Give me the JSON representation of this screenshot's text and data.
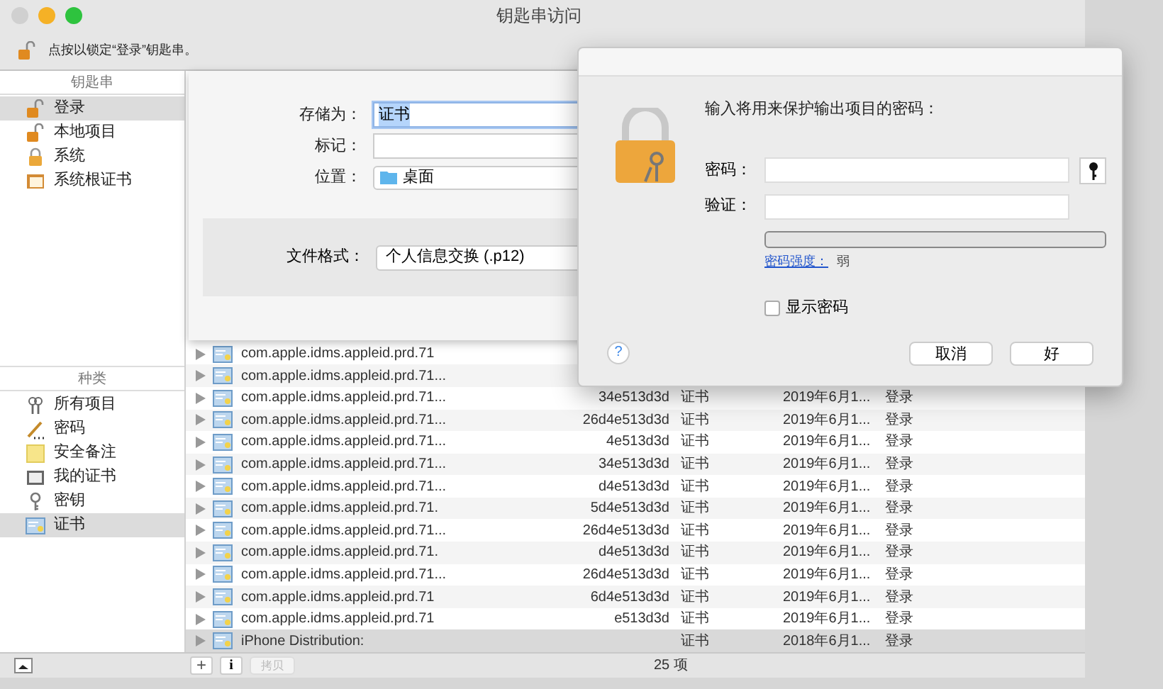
{
  "window": {
    "title": "钥匙串访问"
  },
  "toolbar": {
    "lock_message": "点按以锁定“登录”钥匙串。"
  },
  "sidebar": {
    "keychains": {
      "title": "钥匙串",
      "items": [
        {
          "label": "登录",
          "kind": "unlocked",
          "selected": true
        },
        {
          "label": "本地项目",
          "kind": "unlocked",
          "selected": false
        },
        {
          "label": "系统",
          "kind": "locked",
          "selected": false
        },
        {
          "label": "系统根证书",
          "kind": "cabinet",
          "selected": false
        }
      ]
    },
    "categories": {
      "title": "种类",
      "items": [
        {
          "label": "所有项目",
          "kind": "keys",
          "selected": false
        },
        {
          "label": "密码",
          "kind": "pencil",
          "selected": false
        },
        {
          "label": "安全备注",
          "kind": "note",
          "selected": false
        },
        {
          "label": "我的证书",
          "kind": "mycert",
          "selected": false
        },
        {
          "label": "密钥",
          "kind": "key",
          "selected": false
        },
        {
          "label": "证书",
          "kind": "cert",
          "selected": true
        }
      ]
    }
  },
  "items": [
    {
      "name": "com.apple.idms.appleid.prd.71",
      "selected": false
    },
    {
      "name": "com.apple.idms.appleid.prd.71...",
      "selected": false
    },
    {
      "name": "com.apple.idms.appleid.prd.71...",
      "hash": "34e513d3d",
      "kind": "证书",
      "date": "2019年6月1...",
      "keychain": "登录",
      "selected": false
    },
    {
      "name": "com.apple.idms.appleid.prd.71...",
      "hash": "26d4e513d3d",
      "kind": "证书",
      "date": "2019年6月1...",
      "keychain": "登录",
      "selected": false
    },
    {
      "name": "com.apple.idms.appleid.prd.71...",
      "hash": "4e513d3d",
      "kind": "证书",
      "date": "2019年6月1...",
      "keychain": "登录",
      "selected": false
    },
    {
      "name": "com.apple.idms.appleid.prd.71...",
      "hash": "34e513d3d",
      "kind": "证书",
      "date": "2019年6月1...",
      "keychain": "登录",
      "selected": false
    },
    {
      "name": "com.apple.idms.appleid.prd.71...",
      "hash": "d4e513d3d",
      "kind": "证书",
      "date": "2019年6月1...",
      "keychain": "登录",
      "selected": false
    },
    {
      "name": "com.apple.idms.appleid.prd.71.",
      "hash": "5d4e513d3d",
      "kind": "证书",
      "date": "2019年6月1...",
      "keychain": "登录",
      "selected": false
    },
    {
      "name": "com.apple.idms.appleid.prd.71...",
      "hash": "26d4e513d3d",
      "kind": "证书",
      "date": "2019年6月1...",
      "keychain": "登录",
      "selected": false
    },
    {
      "name": "com.apple.idms.appleid.prd.71.",
      "hash": "d4e513d3d",
      "kind": "证书",
      "date": "2019年6月1...",
      "keychain": "登录",
      "selected": false
    },
    {
      "name": "com.apple.idms.appleid.prd.71...",
      "hash": "26d4e513d3d",
      "kind": "证书",
      "date": "2019年6月1...",
      "keychain": "登录",
      "selected": false
    },
    {
      "name": "com.apple.idms.appleid.prd.71",
      "hash": "6d4e513d3d",
      "kind": "证书",
      "date": "2019年6月1...",
      "keychain": "登录",
      "selected": false
    },
    {
      "name": "com.apple.idms.appleid.prd.71",
      "hash": "e513d3d",
      "kind": "证书",
      "date": "2019年6月1...",
      "keychain": "登录",
      "selected": false
    },
    {
      "name": "iPhone Distribution:",
      "kind": "证书",
      "date": "2018年6月1...",
      "keychain": "登录",
      "selected": true
    }
  ],
  "bottom_bar": {
    "add_button": "+",
    "info_button": "i",
    "copy_button": "拷贝",
    "count": "25 项"
  },
  "save_sheet": {
    "fields": [
      {
        "label": "存储为：",
        "value": "证书",
        "kind": "text"
      },
      {
        "label": "标记：",
        "kind": "text"
      },
      {
        "label": "位置：",
        "value": "桌面",
        "kind": "folder"
      }
    ],
    "format": {
      "label": "文件格式：",
      "value": "个人信息交换 (.p12)"
    }
  },
  "password_dialog": {
    "prompt": "输入将用来保护输出项目的密码：",
    "password_label": "密码：",
    "verify_label": "验证：",
    "strength": {
      "level": 0,
      "label": "密码强度：",
      "value": "弱"
    },
    "show_password": {
      "label": "显示密码",
      "checked": false
    },
    "help": "?",
    "buttons": [
      "取消",
      "好"
    ]
  }
}
